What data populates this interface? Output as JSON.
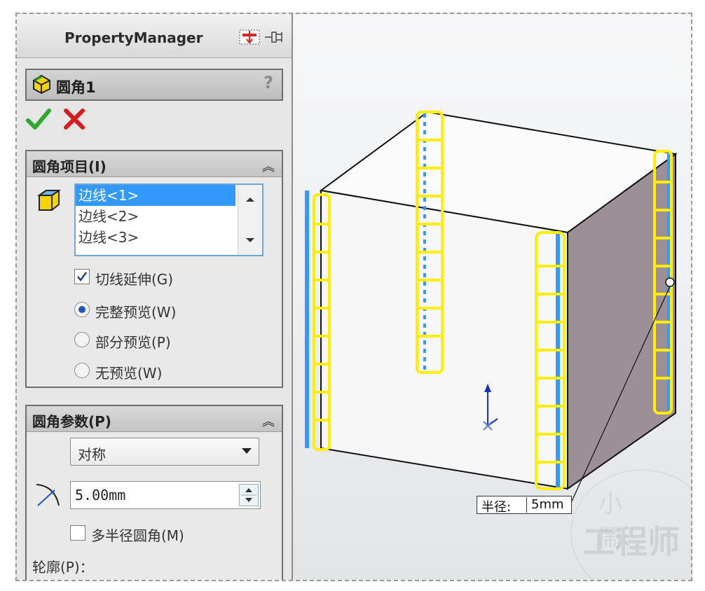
{
  "property_manager": {
    "title": "PropertyManager",
    "feature_name": "圆角1",
    "help_label": "?"
  },
  "actions": {
    "ok_icon": "check-icon",
    "cancel_icon": "x-icon"
  },
  "fillet_items": {
    "title": "圆角项目(I)",
    "edges": [
      "边线<1>",
      "边线<2>",
      "边线<3>"
    ],
    "selected_index": 0,
    "tangent_propagation": {
      "label": "切线延伸(G)",
      "checked": true
    },
    "preview_options": [
      {
        "label": "完整预览(W)",
        "selected": true
      },
      {
        "label": "部分预览(P)",
        "selected": false
      },
      {
        "label": "无预览(W)",
        "selected": false
      }
    ]
  },
  "fillet_params": {
    "title": "圆角参数(P)",
    "method": "对称",
    "radius": "5.00mm",
    "multi_radius": {
      "label": "多半径圆角(M)",
      "checked": false
    },
    "profile_label": "轮廓(P)："
  },
  "viewport": {
    "radius_callout_label": "半径:",
    "radius_callout_value": "5mm",
    "highlight_color": "#ffee00",
    "edge_color": "#3399ff",
    "side_face_color": "#9c8f97"
  },
  "watermark": {
    "line1": "小 鬧",
    "line2": "工程师"
  }
}
